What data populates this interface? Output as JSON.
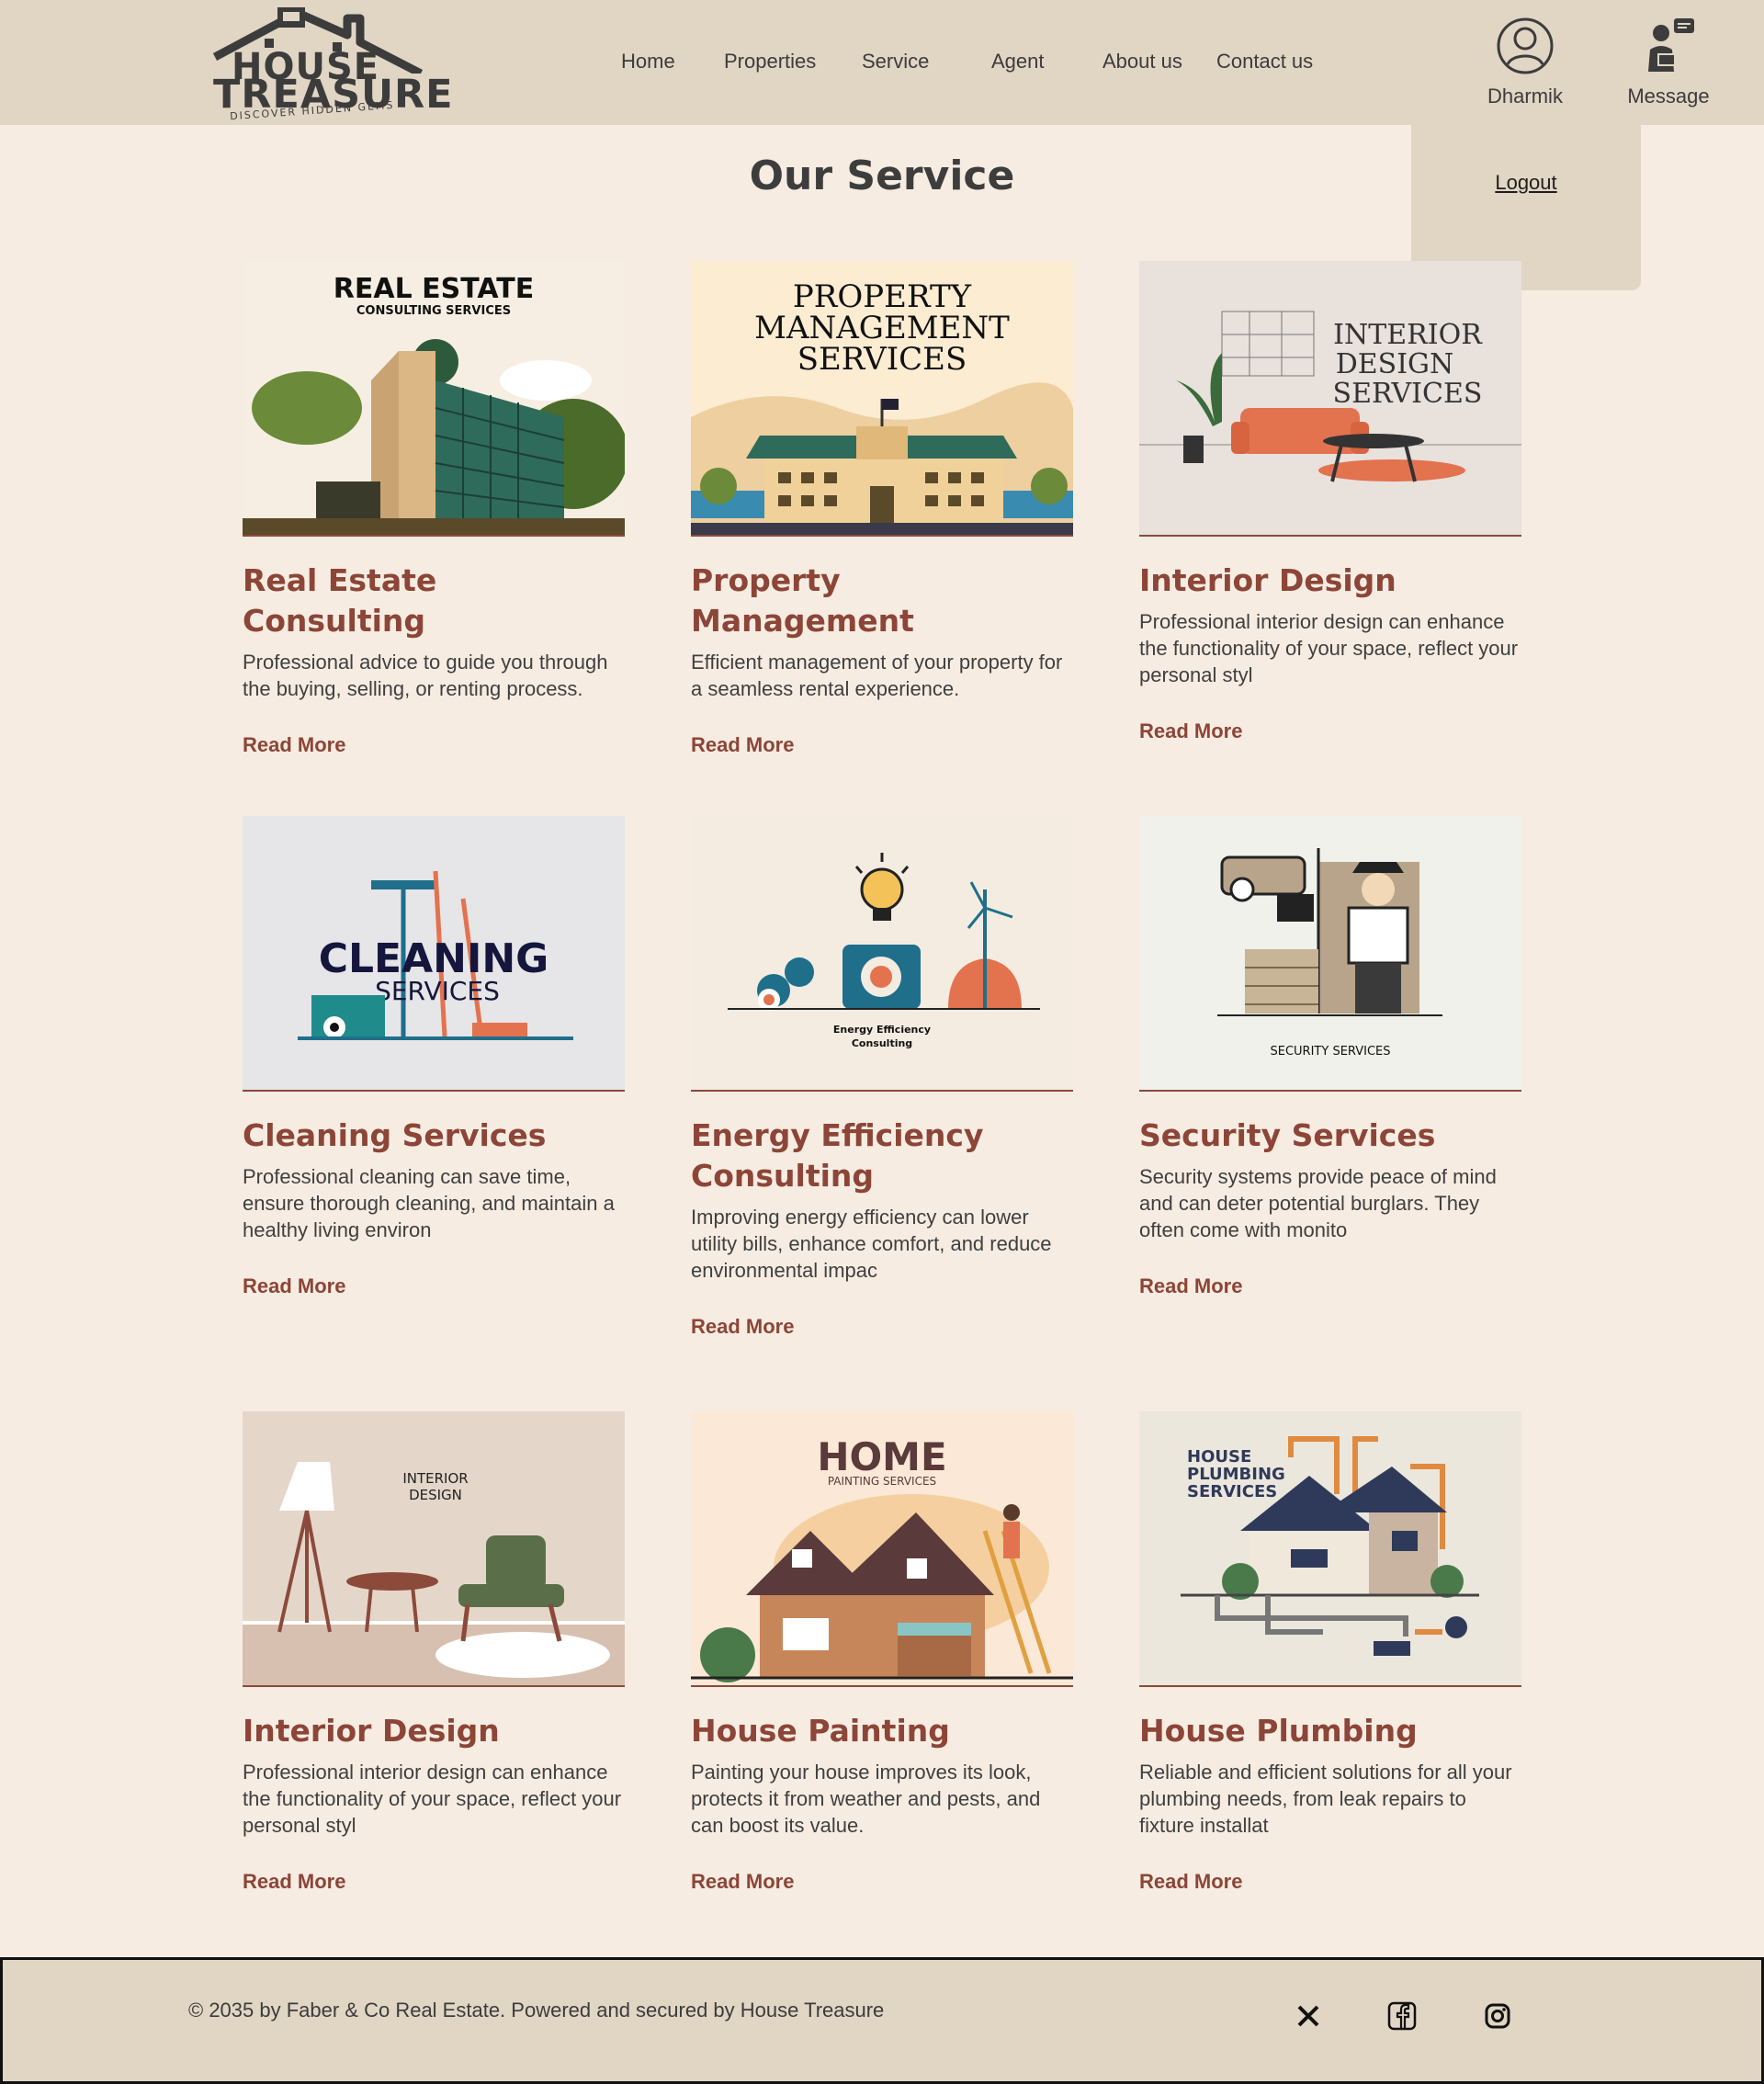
{
  "brand": {
    "line1": "HOUSE",
    "line2": "TREASURE",
    "tagline": "DISCOVER HIDDEN GEMS"
  },
  "nav": [
    {
      "label": "Home"
    },
    {
      "label": "Properties"
    },
    {
      "label": "Service"
    },
    {
      "label": "Agent"
    },
    {
      "label": "About us"
    },
    {
      "label": "Contact us"
    }
  ],
  "user": {
    "name": "Dharmik",
    "icon": "user-circle-icon"
  },
  "message": {
    "label": "Message",
    "icon": "agent-chat-icon"
  },
  "dropdown": {
    "logout_label": "Logout"
  },
  "page": {
    "title": "Our Service"
  },
  "services": [
    {
      "title": "Real Estate Consulting",
      "desc": "Professional advice to guide you through the buying, selling, or renting process.",
      "more": "Read More",
      "image_text": [
        "REAL ESTATE",
        "CONSULTING SERVICES"
      ]
    },
    {
      "title": "Property Management",
      "desc": "Efficient management of your property for a seamless rental experience.",
      "more": "Read More",
      "image_text": [
        "PROPERTY",
        "MANAGEMENT",
        "SERVICES"
      ]
    },
    {
      "title": "Interior Design",
      "desc": "Professional interior design can enhance the functionality of your space, reflect your personal styl",
      "more": "Read More",
      "image_text": [
        "INTERIOR",
        "DESIGN",
        "SERVICES"
      ]
    },
    {
      "title": "Cleaning Services",
      "desc": "Professional cleaning can save time, ensure thorough cleaning, and maintain a healthy living environ",
      "more": "Read More",
      "image_text": [
        "CLEANING",
        "SERVICES"
      ]
    },
    {
      "title": "Energy Efficiency Consulting",
      "desc": "Improving energy efficiency can lower utility bills, enhance comfort, and reduce environmental impac",
      "more": "Read More",
      "image_text": [
        "Energy Efficiency",
        "Consulting"
      ]
    },
    {
      "title": "Security Services",
      "desc": "Security systems provide peace of mind and can deter potential burglars. They often come with monito",
      "more": "Read More",
      "image_text": [
        "SECURITY SERVICES"
      ]
    },
    {
      "title": "Interior Design",
      "desc": "Professional interior design can enhance the functionality of your space, reflect your personal styl",
      "more": "Read More",
      "image_text": [
        "INTERIOR",
        "DESIGN"
      ]
    },
    {
      "title": "House Painting",
      "desc": "Painting your house improves its look, protects it from weather and pests, and can boost its value.",
      "more": "Read More",
      "image_text": [
        "HOME",
        "PAINTING SERVICES"
      ]
    },
    {
      "title": "House Plumbing",
      "desc": "Reliable and efficient solutions for all your plumbing needs, from leak repairs to fixture installat",
      "more": "Read More",
      "image_text": [
        "HOUSE",
        "PLUMBING",
        "SERVICES"
      ]
    }
  ],
  "footer": {
    "copyright": "© 2035 by Faber & Co Real Estate. Powered and secured by House Treasure",
    "social": [
      "x-icon",
      "facebook-icon",
      "instagram-icon"
    ]
  },
  "colors": {
    "background": "#f6ece2",
    "header": "#e1d5c4",
    "accent": "#8c4537"
  }
}
